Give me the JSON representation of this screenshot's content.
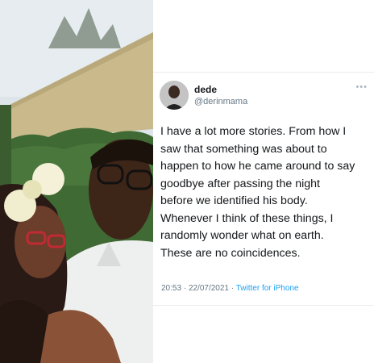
{
  "tweet": {
    "display_name": "dede",
    "handle": "@derinmama",
    "text_lines": [
      "I have a lot more stories. From how I",
      "saw that something was about to",
      "happen to how he came around to say",
      "goodbye after passing the night",
      "before we identified his body.",
      "Whenever I think of these things, I",
      "randomly wonder what on earth.",
      "These are no coincidences."
    ],
    "time": "20:53",
    "separator": "·",
    "date": "22/07/2021",
    "source": "Twitter for iPhone",
    "more_icon": "more-dots-icon"
  },
  "colors": {
    "text": "#14171a",
    "secondary": "#657786",
    "link": "#1da1f2"
  }
}
